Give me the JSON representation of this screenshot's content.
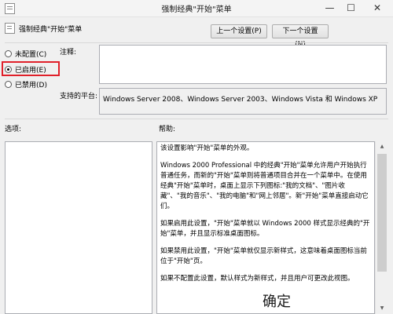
{
  "window": {
    "title": "强制经典\"开始\"菜单",
    "min": "—",
    "max": "☐",
    "close": "✕"
  },
  "policy": {
    "name": "强制经典\"开始\"菜单"
  },
  "nav": {
    "prev": "上一个设置(P)",
    "next": "下一个设置(N)"
  },
  "options": [
    {
      "label": "未配置(C)",
      "selected": false
    },
    {
      "label": "已启用(E)",
      "selected": true
    },
    {
      "label": "已禁用(D)",
      "selected": false
    }
  ],
  "comment": {
    "label": "注释:",
    "value": ""
  },
  "supported": {
    "label": "支持的平台:",
    "value": "Windows Server 2008、Windows Server 2003、Windows Vista 和 Windows XP"
  },
  "sections": {
    "options_label": "选项:",
    "help_label": "帮助:"
  },
  "help": {
    "p1": "该设置影响\"开始\"菜单的外观。",
    "p2": "Windows 2000 Professional 中的经典\"开始\"菜单允许用户开始执行普通任务，而新的\"开始\"菜单则将普通项目合并在一个菜单中。在使用经典\"开始\"菜单时，桌面上显示下列图标:\"我的文档\"、\"图片收藏\"、\"我的音乐\"、\"我的电脑\"和\"网上邻居\"。新\"开始\"菜单直接启动它们。",
    "p3": "如果启用此设置，\"开始\"菜单就以 Windows 2000 样式显示经典的\"开始\"菜单，并且显示标准桌面图标。",
    "p4": "如果禁用此设置，\"开始\"菜单就仅显示新样式，这意味着桌面图标当前位于\"开始\"页。",
    "p5": "如果不配置此设置，默认样式为新样式，并且用户可更改此视图。"
  },
  "overlay": {
    "confirm": "确定"
  }
}
